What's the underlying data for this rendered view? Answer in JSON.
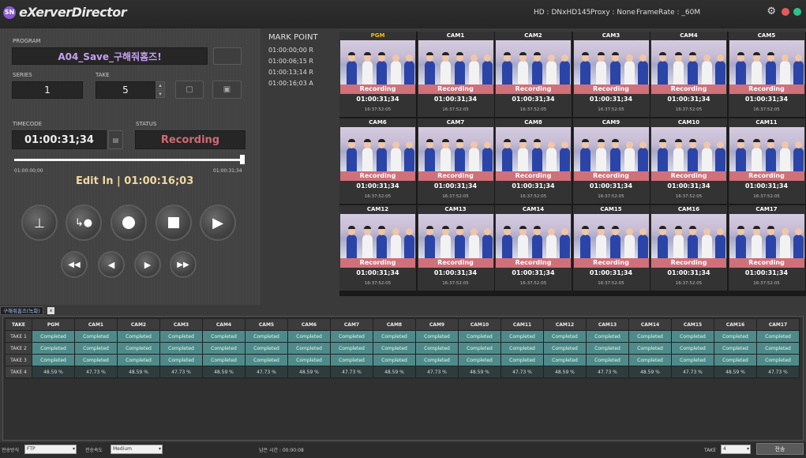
{
  "app": {
    "title": "eXerverDirector",
    "logo_badge": "SN"
  },
  "header": {
    "codec": "HD : DNxHD145",
    "proxy": "Proxy : None",
    "framerate": "FrameRate : _60M"
  },
  "colors": {
    "accent_purple": "#8a5bd0",
    "record_red": "#d07079",
    "completed_teal": "#4f8a8a",
    "dot_red": "#e25b5b",
    "dot_green": "#2fbf8c"
  },
  "program": {
    "label": "PROGRAM",
    "name": "A04_Save_구해줘홈즈!"
  },
  "series": {
    "label": "SERIES",
    "value": "1"
  },
  "take": {
    "label": "TAKE",
    "value": "5"
  },
  "timecode": {
    "label": "TIMECODE",
    "value": "01:00:31;34"
  },
  "status": {
    "label": "STATUS",
    "value": "Recording"
  },
  "timeline": {
    "start": "01:00:00;00",
    "end": "01:00:31;34",
    "progress": 0.99
  },
  "edit_in": "Edit In  |  01:00:16;03",
  "mark_point": {
    "title": "MARK POINT",
    "items": [
      "01:00:00;00 R",
      "01:00:06;15 R",
      "01:00:13;14 R",
      "01:00:16;03 A"
    ]
  },
  "cameras": [
    {
      "name": "PGM",
      "status": "Recording",
      "tc": "01:00:31;34",
      "sub": "16:37:52:05"
    },
    {
      "name": "CAM1",
      "status": "Recording",
      "tc": "01:00:31;34",
      "sub": "16:37:52:05"
    },
    {
      "name": "CAM2",
      "status": "Recording",
      "tc": "01:00:31;34",
      "sub": "16:37:52:05"
    },
    {
      "name": "CAM3",
      "status": "Recording",
      "tc": "01:00:31;34",
      "sub": "16:37:52:05"
    },
    {
      "name": "CAM4",
      "status": "Recording",
      "tc": "01:00:31;34",
      "sub": "16:37:52:05"
    },
    {
      "name": "CAM5",
      "status": "Recording",
      "tc": "01:00:31;34",
      "sub": "16:37:52:05"
    },
    {
      "name": "CAM6",
      "status": "Recording",
      "tc": "01:00:31;34",
      "sub": "16:37:52:05"
    },
    {
      "name": "CAM7",
      "status": "Recording",
      "tc": "01:00:31;34",
      "sub": "16:37:52:05"
    },
    {
      "name": "CAM8",
      "status": "Recording",
      "tc": "01:00:31;34",
      "sub": "16:37:52:05"
    },
    {
      "name": "CAM9",
      "status": "Recording",
      "tc": "01:00:31;34",
      "sub": "16:37:52:05"
    },
    {
      "name": "CAM10",
      "status": "Recording",
      "tc": "01:00:31;34",
      "sub": "16:37:52:05"
    },
    {
      "name": "CAM11",
      "status": "Recording",
      "tc": "01:00:31;34",
      "sub": "16:37:52:05"
    },
    {
      "name": "CAM12",
      "status": "Recording",
      "tc": "01:00:31;34",
      "sub": "16:37:52:05"
    },
    {
      "name": "CAM13",
      "status": "Recording",
      "tc": "01:00:31;34",
      "sub": "16:37:52:05"
    },
    {
      "name": "CAM14",
      "status": "Recording",
      "tc": "01:00:31;34",
      "sub": "16:37:52:05"
    },
    {
      "name": "CAM15",
      "status": "Recording",
      "tc": "01:00:31;34",
      "sub": "16:37:52:05"
    },
    {
      "name": "CAM16",
      "status": "Recording",
      "tc": "01:00:31;34",
      "sub": "16:37:52:05"
    },
    {
      "name": "CAM17",
      "status": "Recording",
      "tc": "01:00:31;34",
      "sub": "16:37:52:05"
    }
  ],
  "tab": {
    "label": "구해줘홈즈(녹화)",
    "close": "x"
  },
  "table": {
    "headers": [
      "TAKE",
      "PGM",
      "CAM1",
      "CAM2",
      "CAM3",
      "CAM4",
      "CAM5",
      "CAM6",
      "CAM7",
      "CAM8",
      "CAM9",
      "CAM10",
      "CAM11",
      "CAM12",
      "CAM13",
      "CAM14",
      "CAM15",
      "CAM16",
      "CAM17"
    ],
    "rows": [
      {
        "take": "TAKE 1",
        "cells": [
          "Completed",
          "Completed",
          "Completed",
          "Completed",
          "Completed",
          "Completed",
          "Completed",
          "Completed",
          "Completed",
          "Completed",
          "Completed",
          "Completed",
          "Completed",
          "Completed",
          "Completed",
          "Completed",
          "Completed",
          "Completed"
        ]
      },
      {
        "take": "TAKE 2",
        "cells": [
          "Completed",
          "Completed",
          "Completed",
          "Completed",
          "Completed",
          "Completed",
          "Completed",
          "Completed",
          "Completed",
          "Completed",
          "Completed",
          "Completed",
          "Completed",
          "Completed",
          "Completed",
          "Completed",
          "Completed",
          "Completed"
        ]
      },
      {
        "take": "TAKE 3",
        "cells": [
          "Completed",
          "Completed",
          "Completed",
          "Completed",
          "Completed",
          "Completed",
          "Completed",
          "Completed",
          "Completed",
          "Completed",
          "Completed",
          "Completed",
          "Completed",
          "Completed",
          "Completed",
          "Completed",
          "Completed",
          "Completed"
        ]
      },
      {
        "take": "TAKE 4",
        "cells": [
          "48.59 %",
          "47.73 %",
          "48.59 %",
          "47.73 %",
          "48.59 %",
          "47.73 %",
          "48.59 %",
          "47.73 %",
          "48.59 %",
          "47.73 %",
          "48.59 %",
          "47.73 %",
          "48.59 %",
          "47.73 %",
          "48.59 %",
          "47.73 %",
          "48.59 %",
          "47.73 %"
        ]
      }
    ]
  },
  "footer": {
    "transfer_method_label": "전송방식",
    "transfer_method_value": "FTP",
    "transfer_speed_label": "전송속도",
    "transfer_speed_value": "Medium",
    "remaining_time": "남은 시간 : 00:00:08",
    "take_label": "TAKE",
    "take_value": "4",
    "send_label": "전송"
  }
}
